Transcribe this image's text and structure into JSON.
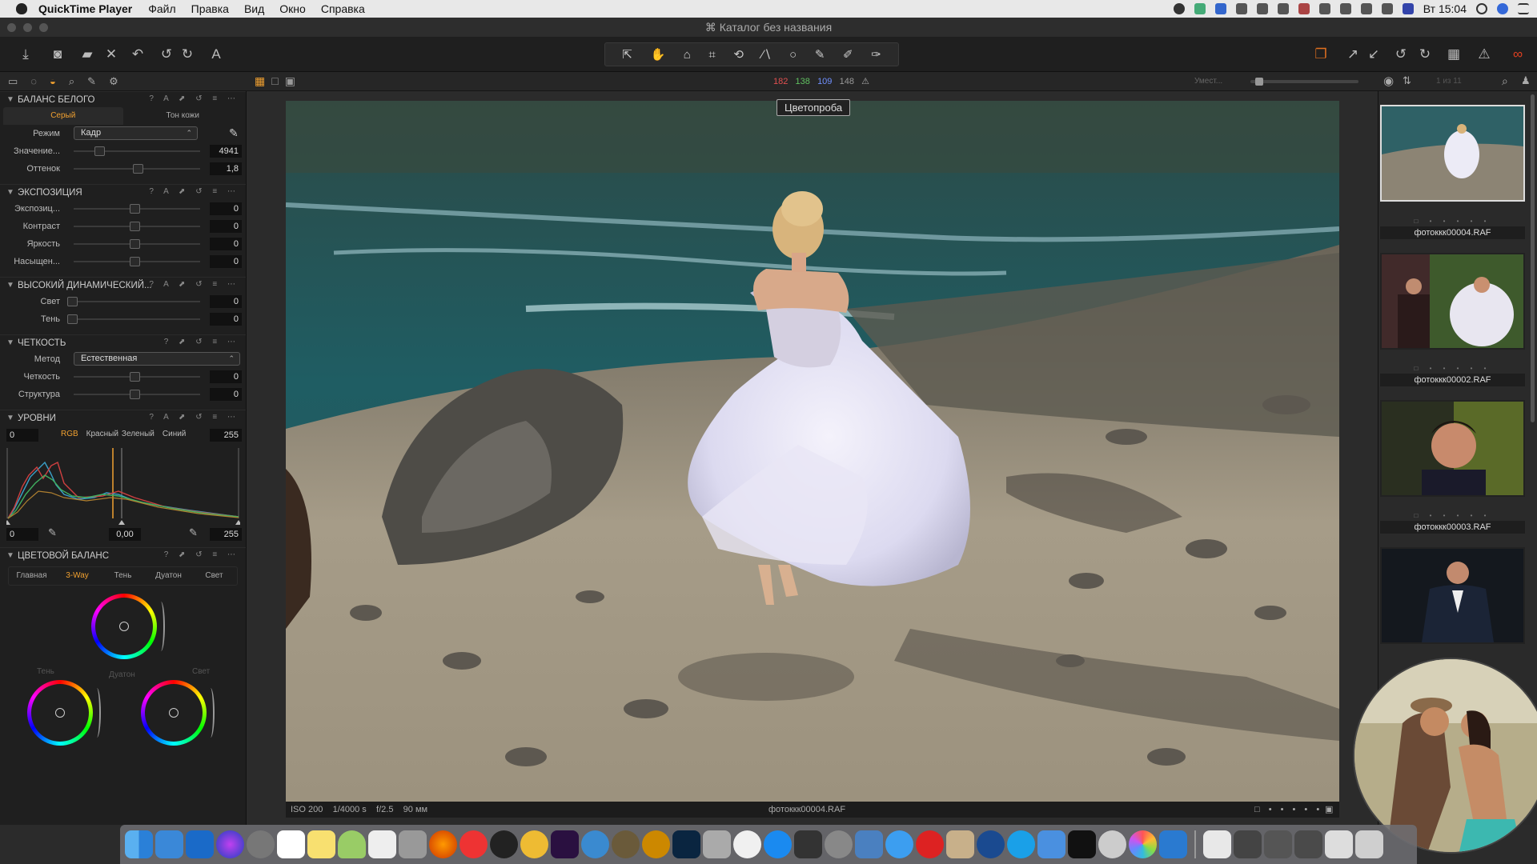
{
  "menubar": {
    "app_name": "QuickTime Player",
    "menus": [
      "Файл",
      "Правка",
      "Вид",
      "Окно",
      "Справка"
    ],
    "clock": "Вт 15:04"
  },
  "window": {
    "title": "Каталог без названия"
  },
  "subbar": {
    "count_red": "182",
    "count_green": "138",
    "count_blue": "109",
    "count_gray": "148",
    "zoom_label": "Умест...",
    "page_counter": "1 из 11"
  },
  "white_balance": {
    "title": "БАЛАНС БЕЛОГО",
    "tab_gray": "Серый",
    "tab_skin": "Тон кожи",
    "mode_label": "Режим",
    "mode_value": "Кадр",
    "value_label": "Значение...",
    "value": "4941",
    "value_level": 0.18,
    "tint_label": "Оттенок",
    "tint": "1,8",
    "tint_level": 0.51
  },
  "exposure": {
    "title": "ЭКСПОЗИЦИЯ",
    "rows": [
      {
        "label": "Экспозиц...",
        "value": "0"
      },
      {
        "label": "Контраст",
        "value": "0"
      },
      {
        "label": "Яркость",
        "value": "0"
      },
      {
        "label": "Насыщен...",
        "value": "0"
      }
    ]
  },
  "hdr": {
    "title": "ВЫСОКИЙ ДИНАМИЧЕСКИЙ...",
    "rows": [
      {
        "label": "Свет",
        "value": "0"
      },
      {
        "label": "Тень",
        "value": "0"
      }
    ]
  },
  "clarity": {
    "title": "ЧЕТКОСТЬ",
    "method_label": "Метод",
    "method_value": "Естественная",
    "rows": [
      {
        "label": "Четкость",
        "value": "0"
      },
      {
        "label": "Структура",
        "value": "0"
      }
    ]
  },
  "levels": {
    "title": "УРОВНИ",
    "left_value": "0",
    "channels": [
      "RGB",
      "Красный",
      "Зеленый",
      "Синий"
    ],
    "right_value": "255",
    "bottom_left": "0",
    "bottom_mid": "0,00",
    "bottom_right": "255"
  },
  "color_balance": {
    "title": "ЦВЕТОВОЙ БАЛАНС",
    "tabs": [
      "Главная",
      "3-Way",
      "Тень",
      "Дуатон",
      "Свет"
    ],
    "label_shadow": "Тень",
    "label_mid": "Дуатон",
    "label_light": "Свет"
  },
  "viewer": {
    "proof_label": "Цветопроба",
    "iso": "ISO 200",
    "shutter": "1/4000 s",
    "aperture": "f/2.5",
    "focal": "90 мм",
    "filename": "фотоккк00004.RAF"
  },
  "filmstrip": [
    {
      "name": "фотоккк00004.RAF"
    },
    {
      "name": "фотоккк00002.RAF"
    },
    {
      "name": "фотоккк00003.RAF"
    }
  ],
  "colors": {
    "accent": "#f0a030",
    "panel": "#1f1f1f",
    "viewer": "#2b2b2b"
  }
}
